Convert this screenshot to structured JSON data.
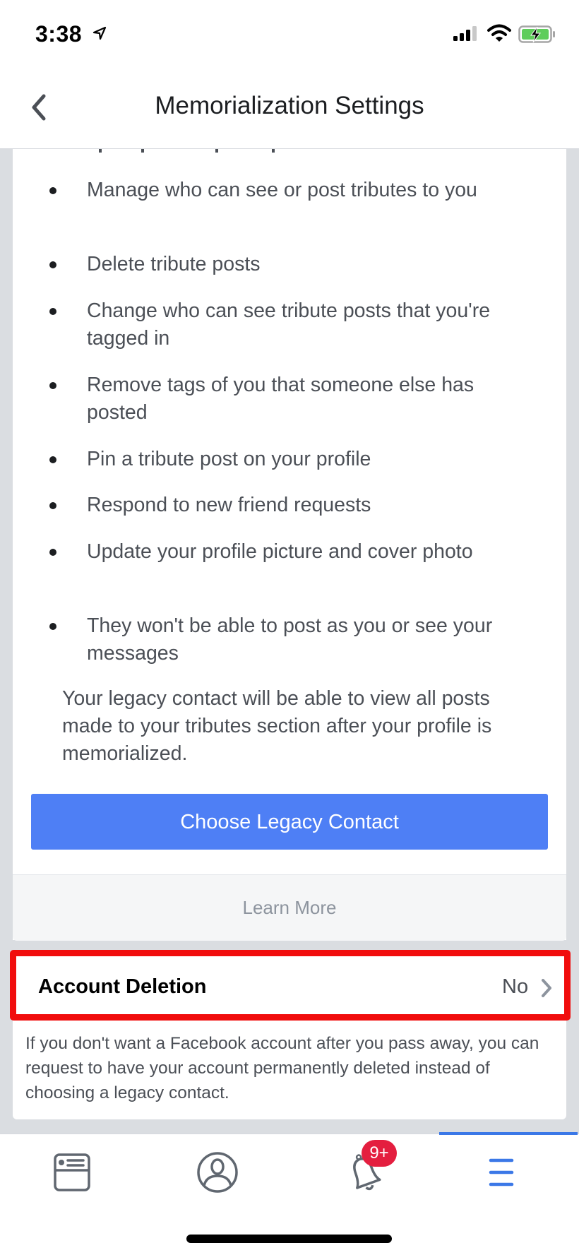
{
  "status_bar": {
    "time": "3:38",
    "location_icon": "location-arrow-icon",
    "signal_icon": "cellular-signal-icon",
    "wifi_icon": "wifi-icon",
    "battery_icon": "battery-charging-icon"
  },
  "header": {
    "back_icon": "chevron-left-icon",
    "title": "Memorialization Settings"
  },
  "legacy_section": {
    "permissions": [
      "Manage who can see or post tributes to you",
      "Delete tribute posts",
      "Change who can see tribute posts that you're tagged in",
      "Remove tags of you that someone else has posted",
      "Pin a tribute post on your profile",
      "Respond to new friend requests",
      "Update your profile picture and cover photo",
      "They won't be able to post as you or see your messages"
    ],
    "paragraph": "Your legacy contact will be able to view all posts made to your tributes section after your profile is memorialized.",
    "choose_button_label": "Choose Legacy Contact",
    "learn_more_label": "Learn More"
  },
  "account_deletion": {
    "label": "Account Deletion",
    "value": "No",
    "description": "If you don't want a Facebook account after you pass away, you can request to have your account permanently deleted instead of choosing a legacy contact."
  },
  "tab_bar": {
    "tabs": [
      {
        "name": "news-feed",
        "icon": "news-feed-icon"
      },
      {
        "name": "profile",
        "icon": "profile-icon"
      },
      {
        "name": "notifications",
        "icon": "bell-icon",
        "badge": "9+"
      },
      {
        "name": "menu",
        "icon": "hamburger-menu-icon",
        "active": true
      }
    ]
  },
  "colors": {
    "primary_button": "#4e7ff5",
    "highlight_box": "#f10d0d",
    "badge": "#e41e3f",
    "active_tab": "#3b78e7",
    "background": "#dadde1"
  }
}
